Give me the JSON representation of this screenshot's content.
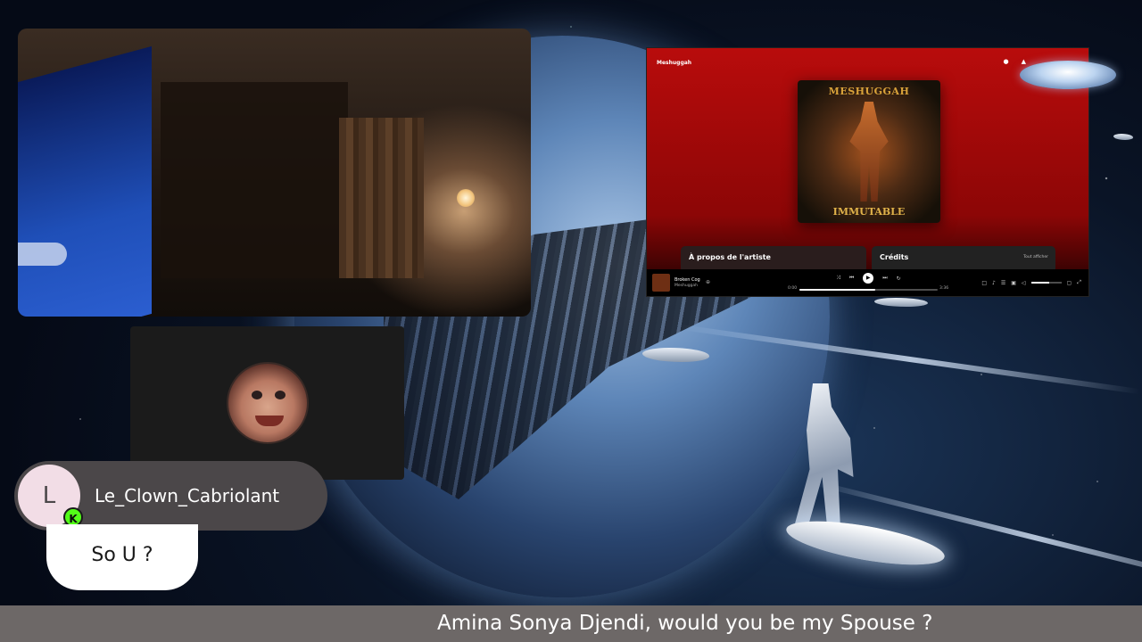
{
  "spotify": {
    "artist": "Meshuggah",
    "album_logo": "MESHUGGAH",
    "album_title": "IMMUTABLE",
    "card_about": "À propos de l'artiste",
    "card_credits": "Crédits",
    "card_show_all": "Tout afficher",
    "track": "Broken Cog",
    "track_artist": "Meshuggah",
    "time_current": "0:00",
    "time_total": "3:36",
    "progress_fraction": 0.55,
    "volume_fraction": 0.6,
    "accent": "#b80c0c"
  },
  "chat": {
    "avatar_letter": "L",
    "platform_badge": "K",
    "username": "Le_Clown_Cabriolant",
    "message": "So U ?",
    "badge_color": "#53fc18"
  },
  "ticker": {
    "text": "Amina Sonya Djendi, would you be my Spouse ?"
  }
}
